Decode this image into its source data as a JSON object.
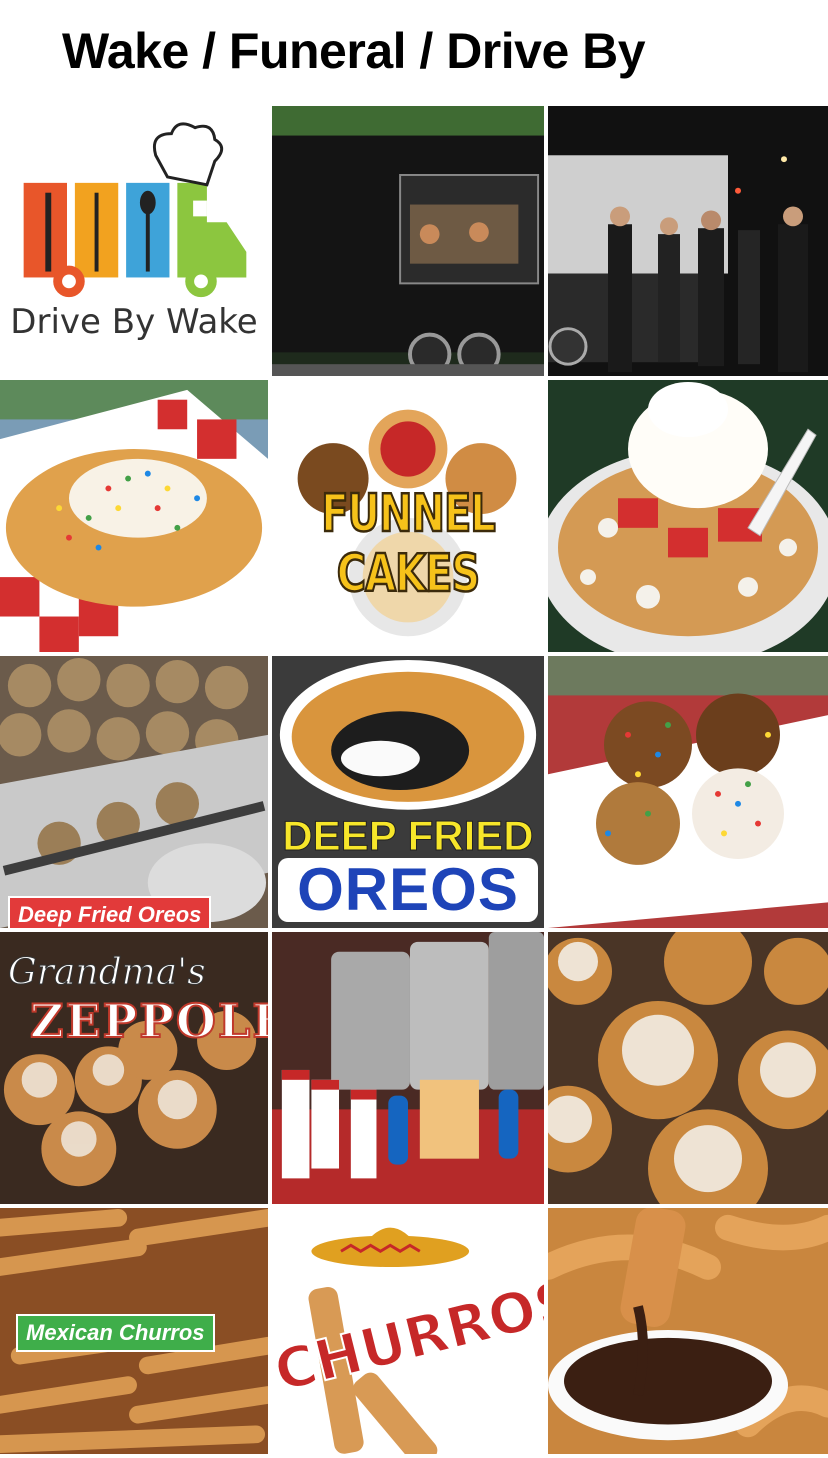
{
  "page": {
    "title": "Wake / Funeral / Drive By"
  },
  "tiles": {
    "logo": {
      "text": "Drive By Wake"
    },
    "truck_day": {},
    "truck_night": {},
    "funnel_sprinkles": {},
    "funnel_logo": {
      "text": "FUNNEL CAKES"
    },
    "funnel_strawberry": {},
    "oreos_trays": {
      "caption": "Deep Fried Oreos"
    },
    "oreos_logo": {
      "line1": "DEEP FRIED",
      "line2": "OREOS"
    },
    "oreos_bowl": {},
    "zeppoles_logo": {
      "script": "Grandma's",
      "text": "ZEPPOLES"
    },
    "coffee_station": {},
    "zeppoles_closeup": {},
    "churros_pile": {
      "caption": "Mexican Churros"
    },
    "churros_logo": {
      "text": "CHURROS"
    },
    "churros_chocolate": {}
  },
  "colors": {
    "logo_orange": "#e8562a",
    "logo_yellow": "#f2a21f",
    "logo_blue": "#3ea3d9",
    "logo_green": "#8cc63f",
    "red_caption": "#e23a3a",
    "green_caption": "#3fae4a",
    "oreos_blue": "#1e44b8",
    "funnel_yellow": "#f6c21a"
  }
}
